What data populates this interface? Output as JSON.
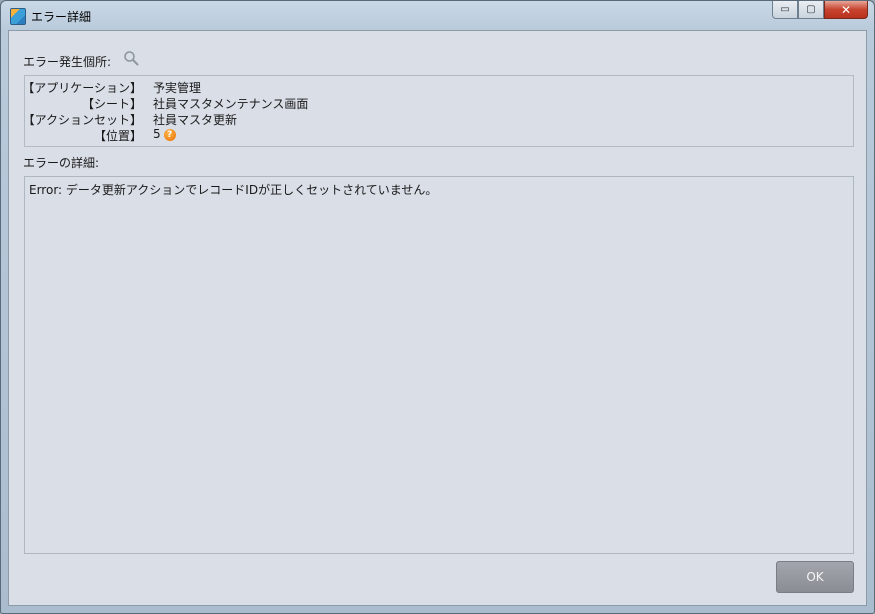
{
  "window": {
    "title": "エラー詳細",
    "controls": {
      "minimize": "▭",
      "maximize": "▢",
      "close": "✕"
    }
  },
  "location": {
    "label": "エラー発生個所:",
    "rows": [
      {
        "key": "【アプリケーション】",
        "value": "予実管理"
      },
      {
        "key": "【シート】",
        "value": "社員マスタメンテナンス画面"
      },
      {
        "key": "【アクションセット】",
        "value": "社員マスタ更新"
      },
      {
        "key": "【位置】",
        "value": "5"
      }
    ],
    "help_glyph": "?"
  },
  "detail": {
    "label": "エラーの詳細:",
    "message": "Error: データ更新アクションでレコードIDが正しくセットされていません。"
  },
  "ok_label": "OK",
  "icons": {
    "app": "app-icon",
    "search": "search-icon",
    "help": "question-circle-icon"
  },
  "colors": {
    "client_bg": "#d9dee7",
    "help_icon": "#e86f00",
    "ok_button": "#8f9399"
  }
}
